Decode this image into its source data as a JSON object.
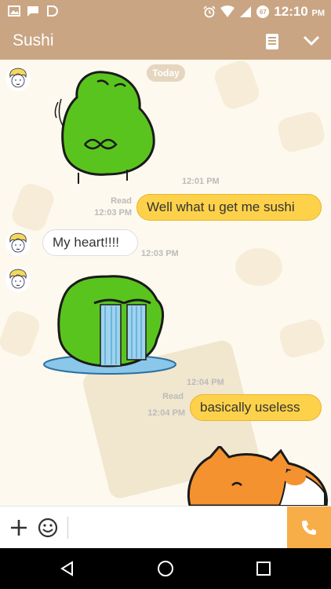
{
  "status_bar": {
    "time": "12:10",
    "ampm": "PM",
    "battery": "67"
  },
  "app_bar": {
    "title": "Sushi"
  },
  "chat": {
    "date_chip": "Today",
    "messages": [
      {
        "type": "sticker",
        "direction": "in",
        "sticker": "green-frog-sticker",
        "time": "12:01 PM"
      },
      {
        "type": "text",
        "direction": "out",
        "text": "Well what u get me sushi",
        "read": "Read",
        "time": "12:03 PM"
      },
      {
        "type": "text",
        "direction": "in",
        "text": "My heart!!!!",
        "time": "12:03 PM"
      },
      {
        "type": "sticker",
        "direction": "in",
        "sticker": "crying-frog-sticker",
        "time": "12:04 PM"
      },
      {
        "type": "text",
        "direction": "out",
        "text": "basically useless",
        "read": "Read",
        "time": "12:04 PM"
      },
      {
        "type": "sticker",
        "direction": "out",
        "sticker": "orange-cat-sticker"
      }
    ]
  },
  "input_bar": {
    "placeholder": ""
  },
  "colors": {
    "header": "#c9a583",
    "outgoing_bubble": "#fdd24a",
    "call_button": "#f7ae48",
    "sticker_green": "#5ac41f"
  },
  "icons": {
    "status_left": [
      "image-icon",
      "chat-icon",
      "notification-icon"
    ],
    "status_right": [
      "alarm-icon",
      "wifi-icon",
      "signal-icon",
      "battery-icon"
    ],
    "header": [
      "notes-icon",
      "chevron-down-icon"
    ],
    "input": [
      "plus-icon",
      "emoji-icon",
      "phone-icon"
    ],
    "nav": [
      "back-icon",
      "home-icon",
      "recents-icon"
    ]
  }
}
